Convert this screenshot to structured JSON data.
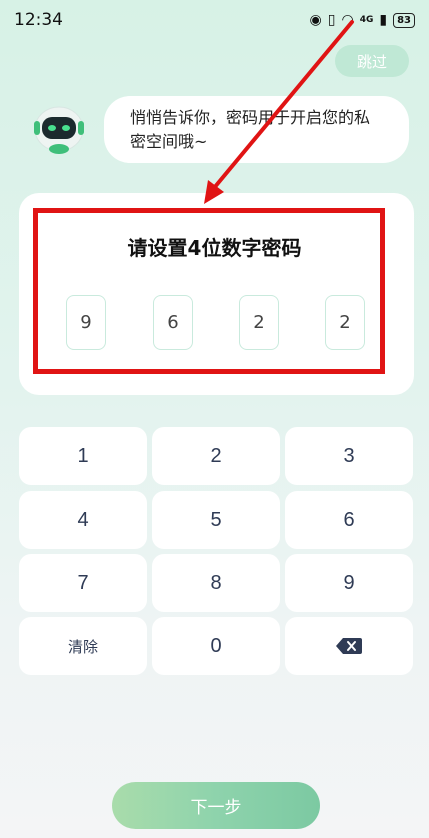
{
  "status": {
    "time": "12:34",
    "network": "4G",
    "battery": "83",
    "icons": [
      "eye-icon",
      "vibrate-icon",
      "wifi-icon",
      "signal-icon",
      "battery-icon"
    ]
  },
  "header": {
    "skip_label": "跳过"
  },
  "assistant": {
    "message": "悄悄告诉你，密码用于开启您的私密空间哦~"
  },
  "password": {
    "title": "请设置4位数字密码",
    "digits": [
      "9",
      "6",
      "2",
      "2"
    ]
  },
  "keypad": {
    "k1": "1",
    "k2": "2",
    "k3": "3",
    "k4": "4",
    "k5": "5",
    "k6": "6",
    "k7": "7",
    "k8": "8",
    "k9": "9",
    "clear": "清除",
    "k0": "0",
    "backspace_icon": "backspace-icon"
  },
  "footer": {
    "next_label": "下一步"
  },
  "colors": {
    "annotation": "#e01414",
    "accent": "#8ed3ac",
    "key_text": "#2f3b55"
  }
}
